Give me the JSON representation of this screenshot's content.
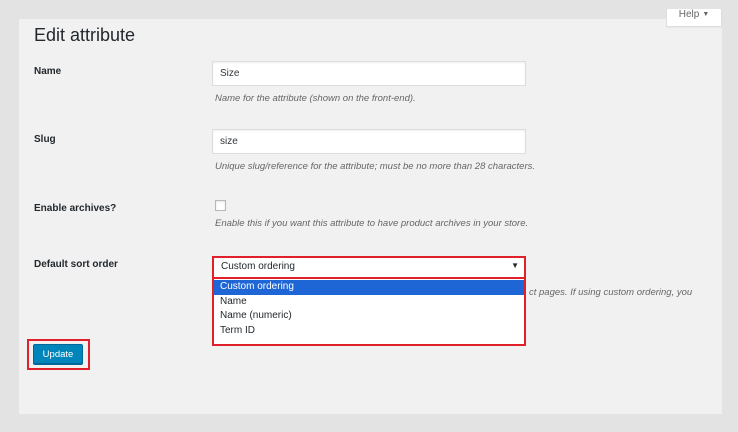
{
  "help_tab": {
    "label": "Help"
  },
  "page_title": "Edit attribute",
  "fields": {
    "name": {
      "label": "Name",
      "value": "Size",
      "description": "Name for the attribute (shown on the front-end)."
    },
    "slug": {
      "label": "Slug",
      "value": "size",
      "description": "Unique slug/reference for the attribute; must be no more than 28 characters."
    },
    "enable_archives": {
      "label": "Enable archives?",
      "checked": false,
      "description": "Enable this if you want this attribute to have product archives in your store."
    },
    "default_sort_order": {
      "label": "Default sort order",
      "selected_value": "Custom ordering",
      "options": [
        "Custom ordering",
        "Name",
        "Name (numeric)",
        "Term ID"
      ],
      "description_visible_part": "ct pages. If using custom ordering, you"
    }
  },
  "update_button": {
    "label": "Update"
  },
  "colors": {
    "highlight_outline": "#e0202b",
    "primary_button": "#0085ba",
    "selected_option": "#1e66d6"
  }
}
